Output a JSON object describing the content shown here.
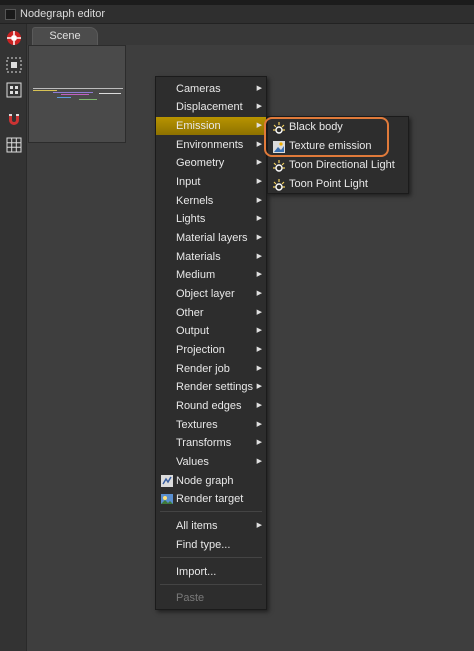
{
  "window": {
    "title": "Nodegraph editor"
  },
  "tabs": [
    {
      "label": "Scene"
    }
  ],
  "toolbar": {
    "buttons": [
      {
        "icon": "octane-logo-icon"
      },
      {
        "icon": "fit-graph-icon"
      },
      {
        "icon": "select-all-icon"
      },
      {
        "icon": "magnet-icon"
      },
      {
        "icon": "grid-icon"
      }
    ]
  },
  "menu": {
    "items": [
      {
        "label": "Cameras",
        "has_submenu": true
      },
      {
        "label": "Displacement",
        "has_submenu": true
      },
      {
        "label": "Emission",
        "has_submenu": true,
        "selected": true
      },
      {
        "label": "Environments",
        "has_submenu": true
      },
      {
        "label": "Geometry",
        "has_submenu": true
      },
      {
        "label": "Input",
        "has_submenu": true
      },
      {
        "label": "Kernels",
        "has_submenu": true
      },
      {
        "label": "Lights",
        "has_submenu": true
      },
      {
        "label": "Material layers",
        "has_submenu": true
      },
      {
        "label": "Materials",
        "has_submenu": true
      },
      {
        "label": "Medium",
        "has_submenu": true
      },
      {
        "label": "Object layer",
        "has_submenu": true
      },
      {
        "label": "Other",
        "has_submenu": true
      },
      {
        "label": "Output",
        "has_submenu": true
      },
      {
        "label": "Projection",
        "has_submenu": true
      },
      {
        "label": "Render job",
        "has_submenu": true
      },
      {
        "label": "Render settings",
        "has_submenu": true
      },
      {
        "label": "Round edges",
        "has_submenu": true
      },
      {
        "label": "Textures",
        "has_submenu": true
      },
      {
        "label": "Transforms",
        "has_submenu": true
      },
      {
        "label": "Values",
        "has_submenu": true
      },
      {
        "label": "Node graph",
        "icon": "node-graph-icon"
      },
      {
        "label": "Render target",
        "icon": "render-target-icon"
      },
      {
        "label": "All items",
        "has_submenu": true
      },
      {
        "label": "Find type..."
      },
      {
        "label": "Import..."
      },
      {
        "label": "Paste",
        "disabled": true
      }
    ]
  },
  "submenu": {
    "items": [
      {
        "label": "Black body",
        "icon": "emission-node-icon"
      },
      {
        "label": "Texture emission",
        "icon": "texture-emission-icon"
      },
      {
        "label": "Toon Directional Light",
        "icon": "emission-node-icon"
      },
      {
        "label": "Toon Point Light",
        "icon": "emission-node-icon"
      }
    ]
  },
  "colors": {
    "selection": "#b89400",
    "highlight_outline": "#e07a3a",
    "menu_bg": "#2d2d2d",
    "canvas_bg": "#3e3e3e"
  }
}
